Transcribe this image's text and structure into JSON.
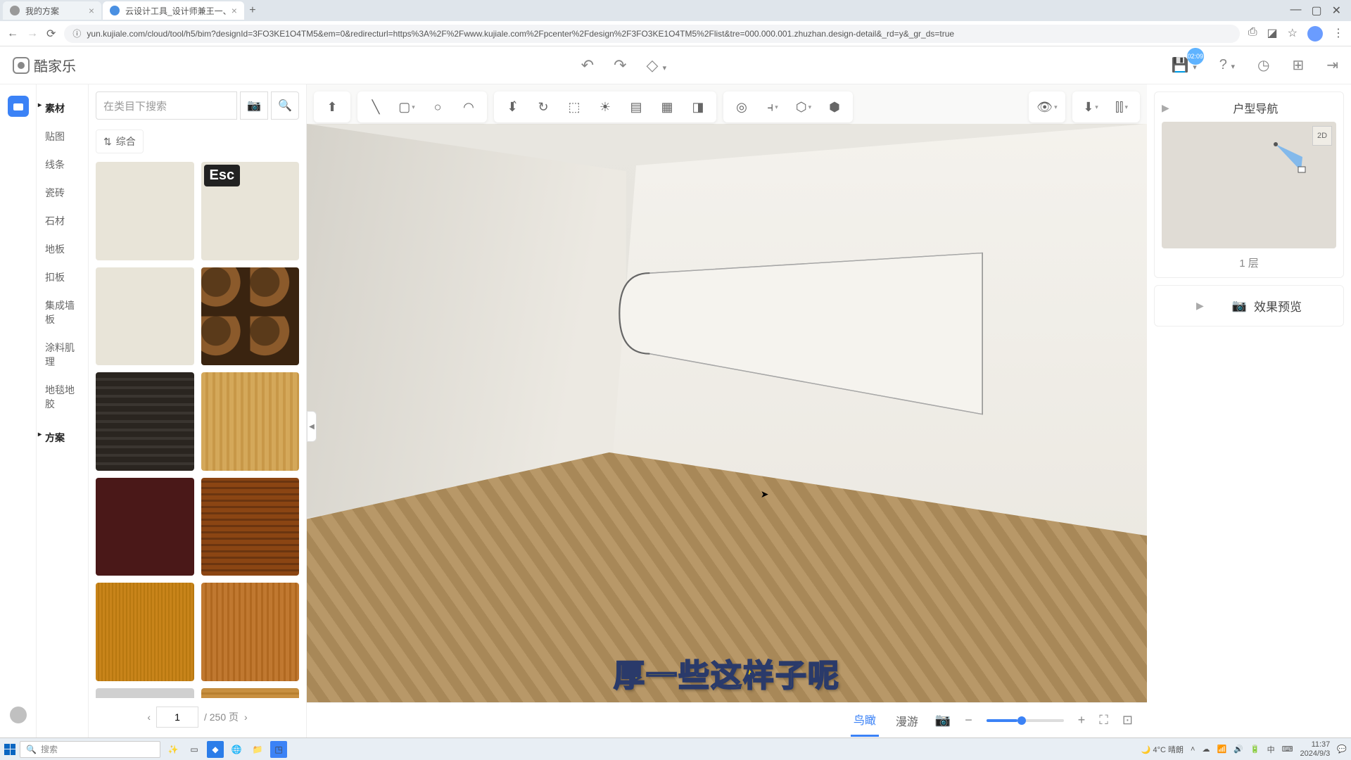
{
  "browser": {
    "tabs": [
      {
        "title": "我的方案"
      },
      {
        "title": "云设计工具_设计师兼王一、"
      }
    ],
    "url": "yun.kujiale.com/cloud/tool/h5/bim?designId=3FO3KE1O4TM5&em=0&redirecturl=https%3A%2F%2Fwww.kujiale.com%2Fpcenter%2Fdesign%2F3FO3KE1O4TM5%2Flist&tre=000.000.001.zhuzhan.design-detail&_rd=y&_gr_ds=true"
  },
  "app": {
    "logo_text": "酷家乐",
    "save_badge": "02:09"
  },
  "sidebar_categories": {
    "head1": "素材",
    "items": [
      "贴图",
      "线条",
      "瓷砖",
      "石材",
      "地板",
      "扣板",
      "集成墙板",
      "涂料肌理",
      "地毯地胶"
    ],
    "head2": "方案"
  },
  "search": {
    "placeholder": "在类目下搜索",
    "filter_label": "综合"
  },
  "esc_label": "Esc",
  "pager": {
    "current": "1",
    "total": "/ 250 页"
  },
  "bottom": {
    "tab_bird": "鸟瞰",
    "tab_roam": "漫游"
  },
  "right": {
    "nav_title": "户型导航",
    "mm_2d": "2D",
    "floor_label": "1 层",
    "preview_title": "效果预览"
  },
  "subtitle": "厚一些这样子呢",
  "taskbar": {
    "search_placeholder": "搜索",
    "weather": "4°C 晴朗",
    "ime": "中",
    "time": "11:37",
    "date": "2024/9/3"
  }
}
